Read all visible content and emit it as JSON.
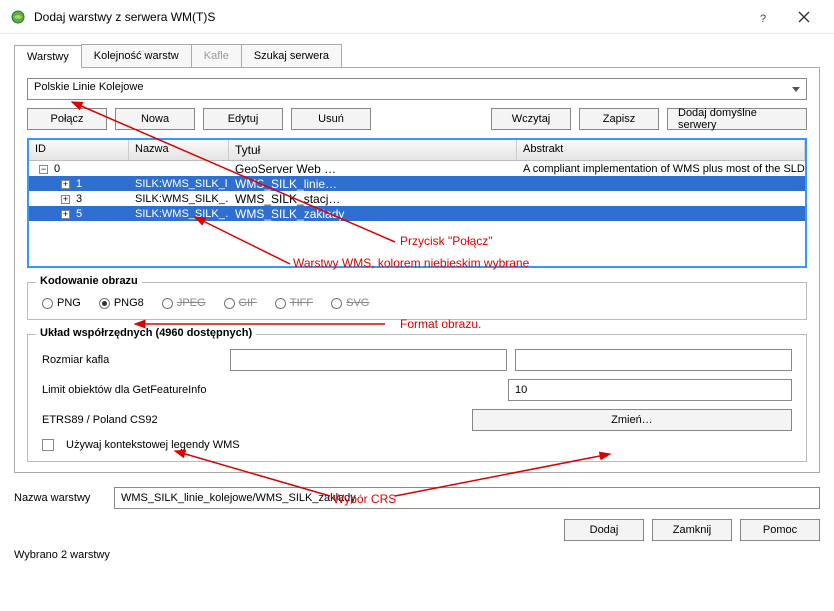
{
  "window": {
    "title": "Dodaj warstwy z serwera WM(T)S"
  },
  "tabs": {
    "layers": "Warstwy",
    "order": "Kolejność warstw",
    "tiles": "Kafle",
    "search": "Szukaj serwera"
  },
  "server": {
    "selected": "Polskie Linie Kolejowe"
  },
  "buttons": {
    "connect": "Połącz",
    "new": "Nowa",
    "edit": "Edytuj",
    "delete": "Usuń",
    "load": "Wczytaj",
    "save": "Zapisz",
    "default": "Dodaj domyślne serwery",
    "change": "Zmień…",
    "add": "Dodaj",
    "close": "Zamknij",
    "help": "Pomoc"
  },
  "grid": {
    "headers": {
      "id": "ID",
      "name": "Nazwa",
      "title": "Tytuł",
      "abstract": "Abstrakt"
    },
    "rows": [
      {
        "id": "0",
        "name": "",
        "title": "GeoServer Web …",
        "abstract": "A compliant implementation of WMS plus most of the SLD extension (dynamic styling)…",
        "level": 0,
        "selected": false
      },
      {
        "id": "1",
        "name": "SILK:WMS_SILK_l…",
        "title": "WMS_SILK_linie…",
        "abstract": "",
        "level": 1,
        "selected": true
      },
      {
        "id": "3",
        "name": "SILK:WMS_SILK_…",
        "title": "WMS_SILK_stacj…",
        "abstract": "",
        "level": 1,
        "selected": false
      },
      {
        "id": "5",
        "name": "SILK:WMS_SILK_…",
        "title": "WMS_SILK_zaklady",
        "abstract": "",
        "level": 1,
        "selected": true
      }
    ]
  },
  "encoding": {
    "group": "Kodowanie obrazu",
    "formats": [
      "PNG",
      "PNG8",
      "JPEG",
      "GIF",
      "TIFF",
      "SVG"
    ],
    "selected": "PNG8",
    "disabled": [
      "JPEG",
      "GIF",
      "TIFF",
      "SVG"
    ]
  },
  "crs": {
    "group": "Układ współrzędnych (4960 dostępnych)",
    "tilesize_label": "Rozmiar kafla",
    "tilesize_value": "",
    "limit_label": "Limit obiektów dla GetFeatureInfo",
    "limit_value": "10",
    "crs_label": "ETRS89 / Poland CS92",
    "context_legend": "Używaj kontekstowej legendy WMS"
  },
  "layer_name": {
    "label": "Nazwa warstwy",
    "value": "WMS_SILK_linie_kolejowe/WMS_SILK_zaklady"
  },
  "status": "Wybrano 2 warstwy",
  "annotations": {
    "connect": "Przycisk \"Połącz\"",
    "layers": "Warstwy WMS, kolorem niebieskim wybrane",
    "format": "Format obrazu.",
    "crs": "Wybór CRS"
  }
}
